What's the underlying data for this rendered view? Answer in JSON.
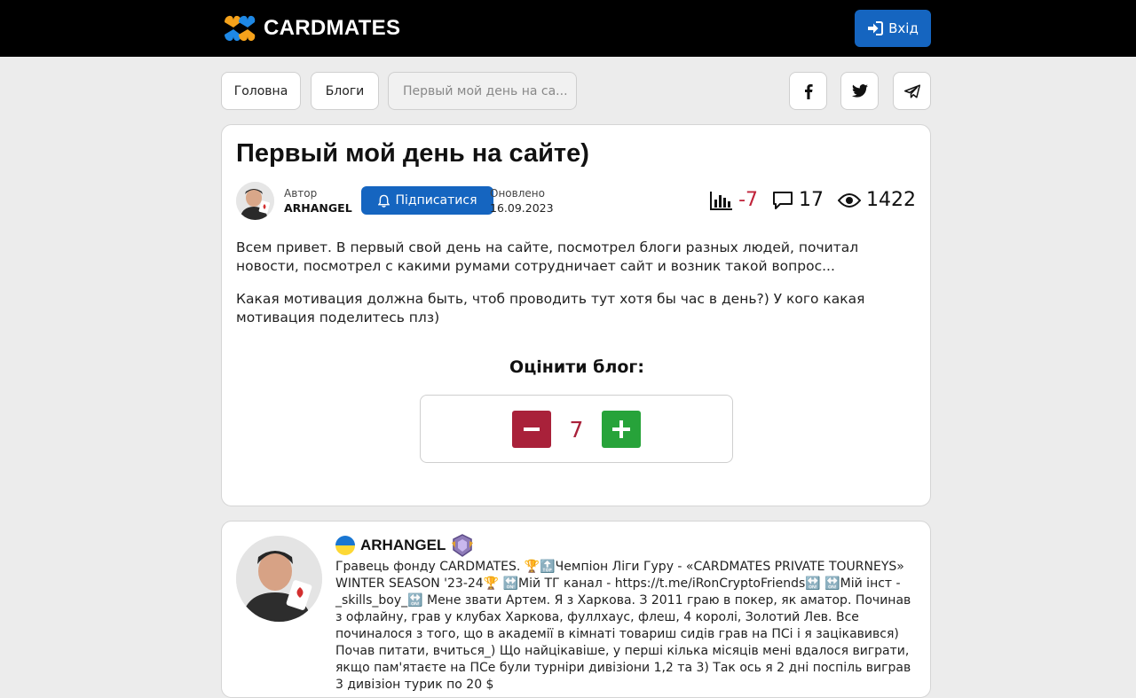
{
  "header": {
    "logo_text": "CARDMATES",
    "login_label": "Вхід"
  },
  "nav": {
    "home_label": "Головна",
    "blogs_label": "Блоги",
    "breadcrumb_current": "Первый мой день на са..."
  },
  "social": {
    "icons": [
      "facebook-icon",
      "twitter-icon",
      "telegram-icon"
    ]
  },
  "post": {
    "title": "Первый мой день на сайте)",
    "author_label": "Автор",
    "author_name": "ARHANGEL",
    "subscribe_label": "Підписатися",
    "updated_label": "Оновлено",
    "updated_date": "16.09.2023",
    "rating": "-7",
    "comments": "17",
    "views": "1422",
    "paragraphs": [
      "Всем привет. В первый свой день на сайте, посмотрел блоги разных людей, почитал новости, посмотрел с какими румами сотрудничает сайт и возник такой вопрос...",
      "Какая мотивация должна быть, чтоб проводить тут хотя бы час в день?) У кого какая мотивация поделитесь плз)"
    ]
  },
  "rate": {
    "title": "Оцінити блог:",
    "value": "7"
  },
  "author_card": {
    "name": "ARHANGEL",
    "bio": "Гравець фонду CARDMATES. 🏆🔝Чемпіон Ліги Гуру - «CARDMATES PRIVATE TOURNEYS» WINTER SEASON '23-24🏆 🔛Мій ТГ канал - https://t.me/iRonCryptoFriends🔛 🔛Мій інст - _skills_boy_🔛 Мене звати Артем. Я з Харкова. З 2011 граю в покер, як аматор. Починав з офлайну, грав у клубах Харкова, фуллхаус, флеш, 4 королі, Золотий Лев. Все починалося з того, що в академії в кімнаті товариш сидів грав на ПСі і я зацікавився) Почав питати, вчиться_) Що найцікавіше, у перші кілька місяців мені вдалося виграти, якщо пам'ятаєте на ПСе були турніри дивізіони 1,2 та 3) Так ось я 2 дні поспіль виграв 3 дивізіон турик по 20 $"
  },
  "colors": {
    "primary": "#1565c0",
    "negative": "#a9213a",
    "positive": "#27a33a",
    "topbar": "#000000"
  }
}
